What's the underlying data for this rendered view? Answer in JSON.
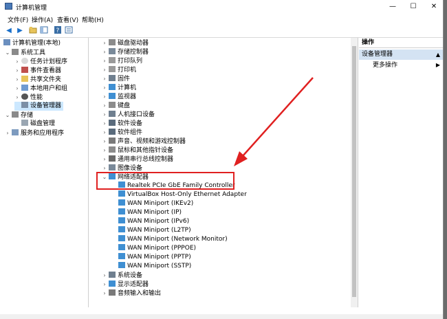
{
  "window": {
    "title": "计算机管理",
    "controls": {
      "minimize": "—",
      "maximize": "☐",
      "close": "✕"
    }
  },
  "menu": [
    "文件(F)",
    "操作(A)",
    "查看(V)",
    "帮助(H)"
  ],
  "left_tree": {
    "root": "计算机管理(本地)",
    "system_tools": "系统工具",
    "items": [
      "任务计划程序",
      "事件查看器",
      "共享文件夹",
      "本地用户和组",
      "性能",
      "设备管理器"
    ],
    "storage": "存储",
    "disk_mgmt": "磁盘管理",
    "services": "服务和应用程序"
  },
  "device_tree": {
    "collapsed_top": [
      "磁盘驱动器",
      "存储控制器",
      "打印队列",
      "打印机",
      "固件",
      "计算机",
      "监视器",
      "键盘",
      "人机接口设备",
      "软件设备",
      "软件组件",
      "声音、视频和游戏控制器",
      "鼠标和其他指针设备",
      "通用串行总线控制器",
      "图像设备"
    ],
    "expanded_category": "网络适配器",
    "adapters": [
      "Realtek PCIe GbE Family Controller",
      "VirtualBox Host-Only Ethernet Adapter",
      "WAN Miniport (IKEv2)",
      "WAN Miniport (IP)",
      "WAN Miniport (IPv6)",
      "WAN Miniport (L2TP)",
      "WAN Miniport (Network Monitor)",
      "WAN Miniport (PPPOE)",
      "WAN Miniport (PPTP)",
      "WAN Miniport (SSTP)"
    ],
    "collapsed_bottom": [
      "系统设备",
      "显示适配器",
      "音频输入和输出"
    ]
  },
  "actions": {
    "header": "操作",
    "selected": "设备管理器",
    "more": "更多操作"
  },
  "colors": {
    "annotation": "#e02020",
    "selection": "#cce8ff"
  }
}
